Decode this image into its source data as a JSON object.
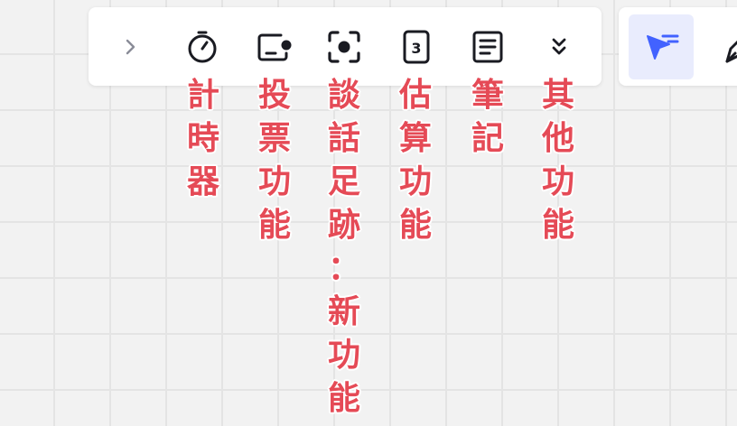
{
  "toolbar": {
    "tools": [
      {
        "id": "expand",
        "icon": "chevron-right-icon"
      },
      {
        "id": "timer",
        "icon": "timer-icon"
      },
      {
        "id": "voting",
        "icon": "voting-icon"
      },
      {
        "id": "talktrack",
        "icon": "focus-record-icon"
      },
      {
        "id": "estimation",
        "icon": "estimation-card-icon"
      },
      {
        "id": "notes",
        "icon": "notes-icon"
      },
      {
        "id": "more",
        "icon": "double-chevron-down-icon"
      }
    ]
  },
  "toolbar2": {
    "tools": [
      {
        "id": "select",
        "icon": "select-pointer-icon",
        "active": true
      },
      {
        "id": "pen",
        "icon": "pen-icon",
        "active": false
      }
    ]
  },
  "annotations": {
    "color": "#e54a56",
    "timer": "計時器",
    "voting": "投票功能",
    "talktrack": "談話足跡：新功能",
    "estimation": "估算功能",
    "notes": "筆記",
    "more": "其他功能"
  },
  "colors": {
    "icon": "#1a1b22",
    "chevron": "#8a8c98",
    "accent": "#4262ff",
    "active_bg": "#e9ecfd"
  }
}
